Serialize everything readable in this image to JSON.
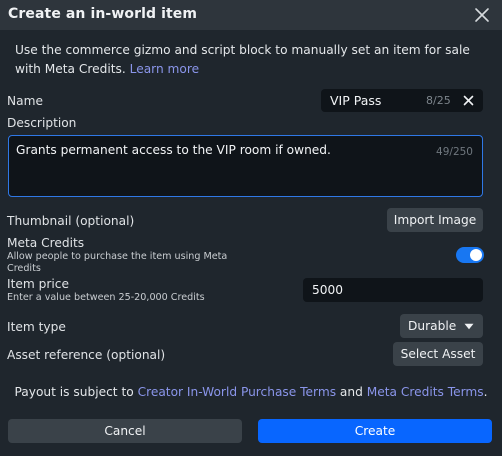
{
  "dialog": {
    "title": "Create an in-world item",
    "intro_text": "Use the commerce gizmo and script block to manually set an item for sale with Meta Credits.",
    "learn_more": "Learn more"
  },
  "name": {
    "label": "Name",
    "value": "VIP Pass",
    "count": "8/25"
  },
  "description": {
    "label": "Description",
    "value": "Grants permanent access to the VIP room if owned.",
    "count": "49/250"
  },
  "thumbnail": {
    "label": "Thumbnail (optional)",
    "button": "Import Image"
  },
  "meta_credits": {
    "label": "Meta Credits",
    "help": "Allow people to purchase the item using Meta Credits",
    "enabled": true
  },
  "item_price": {
    "label": "Item price",
    "help": "Enter a value between 25-20,000 Credits",
    "value": "5000"
  },
  "item_type": {
    "label": "Item type",
    "selected": "Durable"
  },
  "asset_reference": {
    "label": "Asset reference (optional)",
    "button": "Select Asset"
  },
  "payout": {
    "prefix": "Payout is subject to ",
    "link1": "Creator In-World Purchase Terms",
    "middle": " and ",
    "link2": "Meta Credits Terms",
    "suffix": "."
  },
  "footer": {
    "cancel": "Cancel",
    "create": "Create"
  },
  "colors": {
    "accent": "#1877f2",
    "primary_button": "#0866ff",
    "link": "#8a95ea",
    "panel": "#1f262d",
    "titlebar": "#2e353c"
  },
  "icons": {
    "close": "close-icon",
    "clear": "clear-icon",
    "caret": "caret-down-icon"
  }
}
